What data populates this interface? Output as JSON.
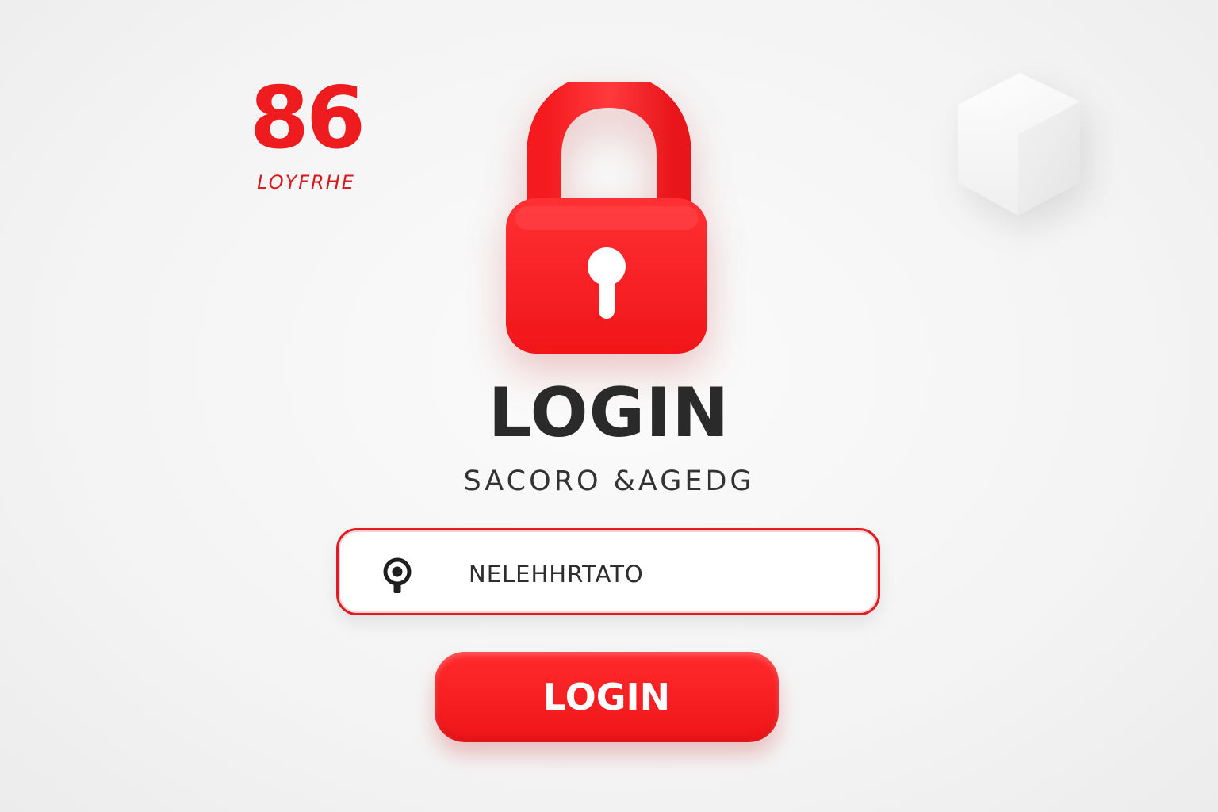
{
  "brand": {
    "number": "86",
    "name": "LOYFRHE",
    "color": "#ee1b1f"
  },
  "hero": {
    "icon": "padlock-icon",
    "color": "#f51b1f"
  },
  "title": "LOGIN",
  "subtitle": "SACORO &AGEDG",
  "input": {
    "icon": "user-pin-icon",
    "value": "NELEHHRTATO",
    "border_color": "#e11b1f"
  },
  "login_button": {
    "label": "LOGIN",
    "color": "#ef1519"
  },
  "decoration": {
    "icon": "cube-icon"
  }
}
